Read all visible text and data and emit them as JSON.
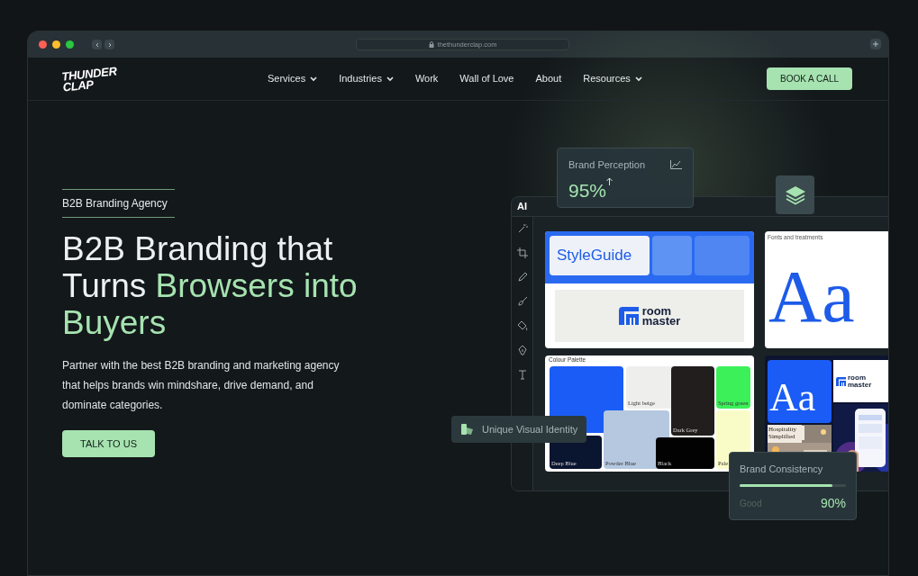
{
  "browser": {
    "url": "thethunderclap.com"
  },
  "nav": {
    "logo": [
      "THUNDER",
      "CLAP"
    ],
    "items": [
      {
        "label": "Services",
        "dropdown": true
      },
      {
        "label": "Industries",
        "dropdown": true
      },
      {
        "label": "Work",
        "dropdown": false
      },
      {
        "label": "Wall of Love",
        "dropdown": false
      },
      {
        "label": "About",
        "dropdown": false
      },
      {
        "label": "Resources",
        "dropdown": true
      }
    ],
    "cta": "BOOK A CALL"
  },
  "hero": {
    "eyebrow": "B2B Branding Agency",
    "headline": [
      {
        "text": "B2B Branding that Turns ",
        "accent": false
      },
      {
        "text": "Browsers into Buyers",
        "accent": true
      }
    ],
    "description": "Partner with the best B2B branding and marketing agency that helps brands win mindshare, drive demand, and dominate categories.",
    "button": "TALK TO US"
  },
  "mockup": {
    "app_label": "AI",
    "styleguide": {
      "title": "StyleGuide",
      "logo": [
        "room",
        "master"
      ]
    },
    "fonts": {
      "caption": "Fonts and treatments",
      "sample": "Aa"
    },
    "palette": {
      "title": "Colour Palette",
      "swatches": [
        {
          "color": "#1a5cf5"
        },
        {
          "label": "Deep Blue",
          "color": "#0a1530"
        },
        {
          "label": "Light beige",
          "color": "#eeeeec"
        },
        {
          "label": "Powder Blue",
          "color": "#b5c8e0"
        },
        {
          "label": "Dark Grey",
          "color": "#231e1e"
        },
        {
          "label": "Black",
          "color": "#020202"
        },
        {
          "label": "Spring green",
          "color": "#3cf05a"
        },
        {
          "label": "Pale",
          "color": "#fafcc8"
        }
      ]
    },
    "collage": {
      "sample": "Aa",
      "logo": [
        "room",
        "master"
      ],
      "hospitality": "Hospitality Simplified"
    }
  },
  "brand_perception": {
    "title": "Brand Perception",
    "value": "95%"
  },
  "tooltip": {
    "label": "Unique Visual Identity"
  },
  "brand_consistency": {
    "title": "Brand Consistency",
    "level": 0.87,
    "status": "Good",
    "value": "90%"
  }
}
